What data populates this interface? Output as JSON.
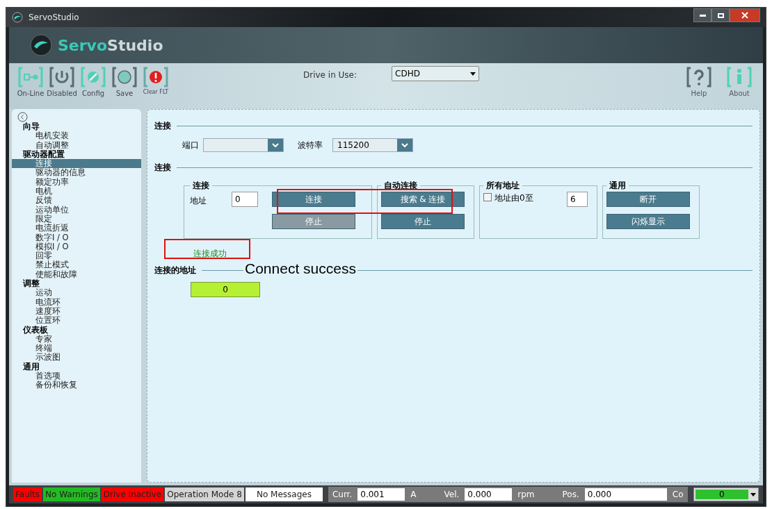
{
  "window": {
    "title": "ServoStudio"
  },
  "banner": {
    "logo_part1": "Servo",
    "logo_part2": "Studio"
  },
  "toolbar": {
    "left": [
      {
        "label": "On-Line",
        "kind": "online"
      },
      {
        "label": "Disabled",
        "kind": "power"
      },
      {
        "label": "Config",
        "kind": "config"
      },
      {
        "label": "Save",
        "kind": "save"
      },
      {
        "label": "Clear FLT",
        "kind": "fault"
      }
    ],
    "drive_label": "Drive in Use:",
    "drive_value": "CDHD",
    "right": [
      {
        "label": "Help",
        "kind": "help"
      },
      {
        "label": "About",
        "kind": "about"
      }
    ]
  },
  "sidebar": {
    "items": [
      {
        "label": "向导",
        "children": [
          {
            "label": "电机安装",
            "selected": false
          },
          {
            "label": "自动调整",
            "selected": false
          }
        ]
      },
      {
        "label": "驱动器配置",
        "children": [
          {
            "label": "连接",
            "selected": true
          },
          {
            "label": "驱动器的信息",
            "selected": false
          },
          {
            "label": "额定功率",
            "selected": false
          },
          {
            "label": "电机",
            "selected": false
          },
          {
            "label": "反馈",
            "selected": false
          },
          {
            "label": "运动单位",
            "selected": false
          },
          {
            "label": "限定",
            "selected": false
          },
          {
            "label": "电流折返",
            "selected": false
          },
          {
            "label": "数字I / O",
            "selected": false
          },
          {
            "label": "模拟I / O",
            "selected": false
          },
          {
            "label": "回零",
            "selected": false
          },
          {
            "label": "禁止模式",
            "selected": false
          },
          {
            "label": "使能和故障",
            "selected": false
          }
        ]
      },
      {
        "label": "调整",
        "children": [
          {
            "label": "运动",
            "selected": false
          },
          {
            "label": "电流环",
            "selected": false
          },
          {
            "label": "速度环",
            "selected": false
          },
          {
            "label": "位置环",
            "selected": false
          }
        ]
      },
      {
        "label": "仪表板",
        "children": [
          {
            "label": "专家",
            "selected": false
          },
          {
            "label": "终端",
            "selected": false
          },
          {
            "label": "示波图",
            "selected": false
          }
        ]
      },
      {
        "label": "通用",
        "children": [
          {
            "label": "首选项",
            "selected": false
          },
          {
            "label": "备份和恢复",
            "selected": false
          }
        ]
      }
    ]
  },
  "main": {
    "section1": "连接",
    "port_label": "端口",
    "baud_label": "波特率",
    "baud_value": "115200",
    "section2": "连接",
    "groups": [
      {
        "title": "连接",
        "address_label": "地址",
        "address_value": "0",
        "buttons": [
          {
            "label": "连接",
            "disabled": false
          },
          {
            "label": "停止",
            "disabled": true
          }
        ]
      },
      {
        "title": "自动连接",
        "buttons": [
          {
            "label": "搜索 & 连接",
            "disabled": false
          },
          {
            "label": "停止",
            "disabled": false
          }
        ]
      },
      {
        "title": "所有地址",
        "checkbox_label": "地址由0至",
        "checked": false,
        "value": "6"
      },
      {
        "title": "通用",
        "buttons": [
          {
            "label": "断开",
            "disabled": false
          },
          {
            "label": "闪烁显示",
            "disabled": false
          }
        ]
      }
    ],
    "status_text": "连接成功",
    "annotation": "Connect success",
    "section3": "连接的地址",
    "connected_address": "0"
  },
  "status_bar": {
    "indicators": [
      {
        "label": "Faults",
        "color": "#ff0000"
      },
      {
        "label": "No Warnings",
        "color": "#22bb22"
      },
      {
        "label": "Drive Inactive",
        "color": "#ff0000"
      },
      {
        "label": "Operation Mode 8",
        "color": "#d4d4d4"
      },
      {
        "label": "No Messages",
        "color": "#ffffff"
      }
    ],
    "readings": [
      {
        "label": "Curr.",
        "value": "0.001",
        "unit": "A"
      },
      {
        "label": "Vel.",
        "value": "0.000",
        "unit": "rpm"
      },
      {
        "label": "Pos.",
        "value": "0.000",
        "unit": "Co"
      }
    ],
    "selector_value": "0"
  }
}
